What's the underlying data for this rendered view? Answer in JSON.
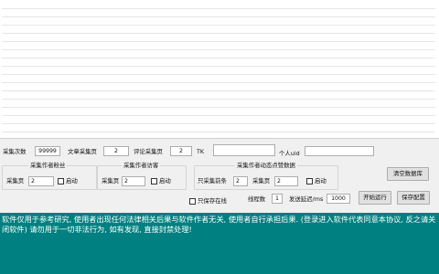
{
  "params": {
    "collect_count_label": "采集次数",
    "collect_count_value": "99999",
    "article_pages_label": "文章采集页",
    "article_pages_value": "2",
    "comment_pages_label": "评论采集页",
    "comment_pages_value": "2",
    "tk_label": "TK",
    "tk_value": "",
    "uid_label": "个人uid",
    "uid_value": ""
  },
  "group_fans": {
    "title": "采集作者粉丝",
    "pages_label": "采集页",
    "pages_value": "2",
    "enable_label": "启动"
  },
  "group_visitors": {
    "title": "采集作者访客",
    "pages_label": "采集页",
    "pages_value": "2",
    "enable_label": "启动"
  },
  "group_likes": {
    "title": "采集作者动态点赞数据",
    "front_label": "只采集前条",
    "front_value": "2",
    "pages_label": "采集页",
    "pages_value": "2",
    "enable_label": "启动"
  },
  "controls": {
    "online_only_label": "只保存在线",
    "threads_label": "线程数",
    "threads_value": "1",
    "delay_label": "发送延迟/ms",
    "delay_value": "1000",
    "clear_db_label": "清空数据库",
    "start_label": "开始运行",
    "save_config_label": "保存配置"
  },
  "console": {
    "text": "软件仅用于参考研究, 使用者出现任何法律相关后果与软件作者无关, 使用者自行承担后果. (登录进入软件代表同意本协议, 反之请关闭软件) 请勿用于一切非法行为, 如有发现, 直接封禁处理!"
  },
  "colors": {
    "console_bg": "#008080",
    "console_text": "#ffffff"
  }
}
